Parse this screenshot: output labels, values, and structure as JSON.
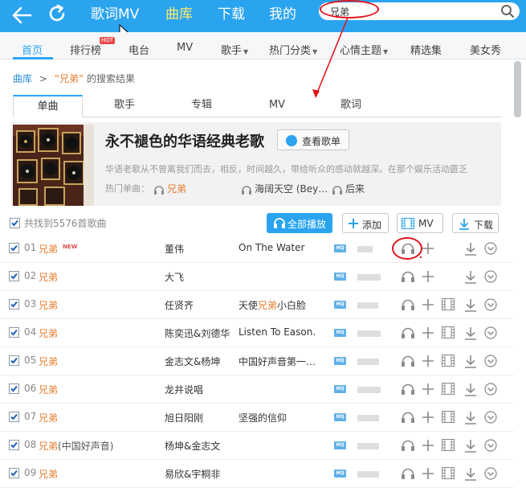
{
  "topbar": {
    "back_icon": "back-arrow-icon",
    "refresh_icon": "refresh-icon",
    "nav": [
      {
        "label": "歌词MV",
        "active": false
      },
      {
        "label": "曲库",
        "active": true
      },
      {
        "label": "下载",
        "active": false
      },
      {
        "label": "我的",
        "active": false
      }
    ],
    "search_value": "兄弟",
    "accent": "#2ba4f0",
    "active_color": "#ffe86a"
  },
  "subnav": {
    "items": [
      {
        "label": "首页",
        "active": true
      },
      {
        "label": "排行榜",
        "badge": "HOT"
      },
      {
        "label": "电台"
      },
      {
        "label": "MV"
      },
      {
        "label": "歌手",
        "dropdown": true
      },
      {
        "label": "热门分类",
        "dropdown": true
      },
      {
        "label": "心情主题",
        "dropdown": true
      },
      {
        "label": "精选集"
      },
      {
        "label": "美女秀"
      }
    ]
  },
  "breadcrumb": {
    "root": "曲库",
    "sep": ">",
    "keyword": "“兄弟”",
    "suffix": "的搜索结果"
  },
  "tabs": [
    "单曲",
    "歌手",
    "专辑",
    "MV",
    "歌词"
  ],
  "banner": {
    "title": "永不褪色的华语经典老歌",
    "button": "查看歌单",
    "desc": "华语老歌从不曾离我们而去，相反，时间越久，带给听众的感动就越深。在那个娱乐活动匮乏",
    "hot_label": "热门单曲：",
    "hot_songs": [
      "兄弟",
      "海阔天空 (Bey…",
      "后来"
    ]
  },
  "toolbar": {
    "count_text": "共找到5576首歌曲",
    "play_all": "全部播放",
    "add": "添加",
    "mv": "MV",
    "download": "下载"
  },
  "songs": [
    {
      "num": "01",
      "name": "兄弟",
      "extra": "",
      "new": "NEW",
      "singer": "董伟",
      "album": "On The Water",
      "album_hl": "",
      "album_post": "",
      "bar": 0.6,
      "mv": false
    },
    {
      "num": "02",
      "name": "兄弟",
      "extra": "",
      "new": "",
      "singer": "大飞",
      "album": "",
      "album_hl": "",
      "album_post": "",
      "bar": 0.9,
      "mv": false
    },
    {
      "num": "03",
      "name": "兄弟",
      "extra": "",
      "new": "",
      "singer": "任贤齐",
      "album": "天使",
      "album_hl": "兄弟",
      "album_post": "小白脸",
      "bar": 0.8,
      "mv": true
    },
    {
      "num": "04",
      "name": "兄弟",
      "extra": "",
      "new": "",
      "singer": "陈奕迅&刘德华",
      "album": "Listen To Eason…",
      "album_hl": "",
      "album_post": "",
      "bar": 0.9,
      "mv": true
    },
    {
      "num": "05",
      "name": "兄弟",
      "extra": "",
      "new": "",
      "singer": "金志文&杨坤",
      "album": "中国好声音第一…",
      "album_hl": "",
      "album_post": "",
      "bar": 0.85,
      "mv": true
    },
    {
      "num": "06",
      "name": "兄弟",
      "extra": "",
      "new": "",
      "singer": "龙井说唱",
      "album": "",
      "album_hl": "",
      "album_post": "",
      "bar": 0.9,
      "mv": true
    },
    {
      "num": "07",
      "name": "兄弟",
      "extra": "",
      "new": "",
      "singer": "旭日阳刚",
      "album": "坚强的信仰",
      "album_hl": "",
      "album_post": "",
      "bar": 0.85,
      "mv": true
    },
    {
      "num": "08",
      "name": "兄弟",
      "extra": "(中国好声音)",
      "new": "",
      "singer": "杨坤&金志文",
      "album": "",
      "album_hl": "",
      "album_post": "",
      "bar": 0.85,
      "mv": true
    },
    {
      "num": "09",
      "name": "兄弟",
      "extra": "",
      "new": "",
      "singer": "易欣&宇桐非",
      "album": "",
      "album_hl": "",
      "album_post": "",
      "bar": 0.85,
      "mv": true
    }
  ]
}
